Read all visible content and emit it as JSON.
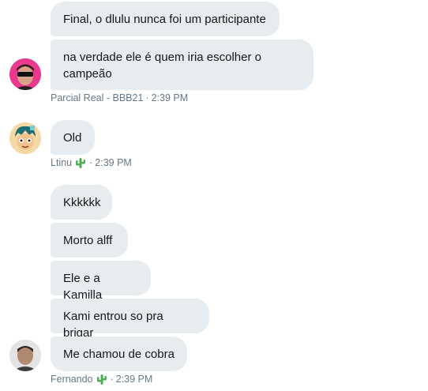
{
  "group1": {
    "messages": [
      "Final, o dlulu nunca foi um participante",
      "na verdade ele é quem iria escolher o campeão"
    ],
    "sender": "Parcial Real - BBB21",
    "sep": "·",
    "time": "2:39 PM"
  },
  "group2": {
    "messages": [
      "Old"
    ],
    "sender": "Ltinu",
    "sep": "·",
    "time": "2:39 PM"
  },
  "group3": {
    "messages": [
      "Kkkkkk",
      "Morto alff",
      "Ele e a Kamilla",
      "Kami entrou so pra brigar",
      "Me chamou de cobra"
    ],
    "sender": "Fernando",
    "sep": "·",
    "time": "2:39 PM"
  },
  "colors": {
    "bubble": "#e6ecf0",
    "meta": "#657786",
    "text": "#14171a",
    "cactus": "#4caf50"
  },
  "icons": {
    "cactus": "cactus-icon"
  }
}
